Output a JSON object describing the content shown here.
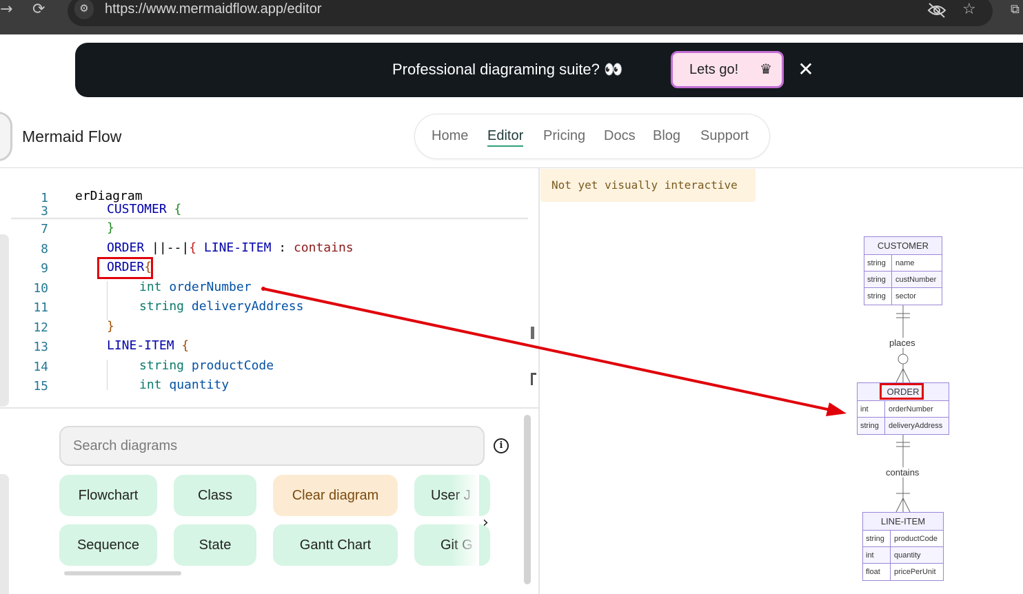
{
  "browser": {
    "url": "https://www.mermaidflow.app/editor"
  },
  "banner": {
    "text": "Professional diagraming suite? 👀",
    "cta_label": "Lets go!",
    "close_glyph": "✕"
  },
  "header": {
    "brand": "Mermaid Flow",
    "nav": [
      "Home",
      "Editor",
      "Pricing",
      "Docs",
      "Blog",
      "Support"
    ],
    "active_nav": "Editor"
  },
  "editor": {
    "line_numbers": [
      "1",
      "3",
      "7",
      "8",
      "9",
      "10",
      "11",
      "12",
      "13",
      "14",
      "15"
    ],
    "lines": {
      "l1": "erDiagram",
      "l3_name": "CUSTOMER",
      "l3_brace": "{",
      "l7": "}",
      "l8_a": "ORDER",
      "l8_b": " ||--|",
      "l8_c": "{",
      "l8_d": " LINE-ITEM",
      "l8_e": " : ",
      "l8_f": "contains",
      "l9_name": "ORDER",
      "l9_brace": "{",
      "l10_type": "int",
      "l10_name": " orderNumber",
      "l11_type": "string",
      "l11_name": " deliveryAddress",
      "l12": "}",
      "l13_name": "LINE-ITEM",
      "l13_brace": "{",
      "l14_type": "string",
      "l14_name": " productCode",
      "l15_type": "int",
      "l15_name": " quantity"
    }
  },
  "gallery": {
    "search_placeholder": "Search diagrams",
    "chips_row1": [
      "Flowchart",
      "Class",
      "Clear diagram",
      "User J"
    ],
    "chips_row2": [
      "Sequence",
      "State",
      "Gantt Chart",
      "Git G"
    ]
  },
  "preview": {
    "notice": "Not yet visually interactive",
    "entities": {
      "customer": {
        "name": "CUSTOMER",
        "attributes": [
          {
            "type": "string",
            "name": "name"
          },
          {
            "type": "string",
            "name": "custNumber"
          },
          {
            "type": "string",
            "name": "sector"
          }
        ]
      },
      "order": {
        "name": "ORDER",
        "attributes": [
          {
            "type": "int",
            "name": "orderNumber"
          },
          {
            "type": "string",
            "name": "deliveryAddress"
          }
        ]
      },
      "line_item": {
        "name": "LINE-ITEM",
        "attributes": [
          {
            "type": "string",
            "name": "productCode"
          },
          {
            "type": "int",
            "name": "quantity"
          },
          {
            "type": "float",
            "name": "pricePerUnit"
          }
        ]
      }
    },
    "relations": {
      "places": "places",
      "contains": "contains"
    }
  },
  "annotation": {
    "color": "#e0000a"
  }
}
